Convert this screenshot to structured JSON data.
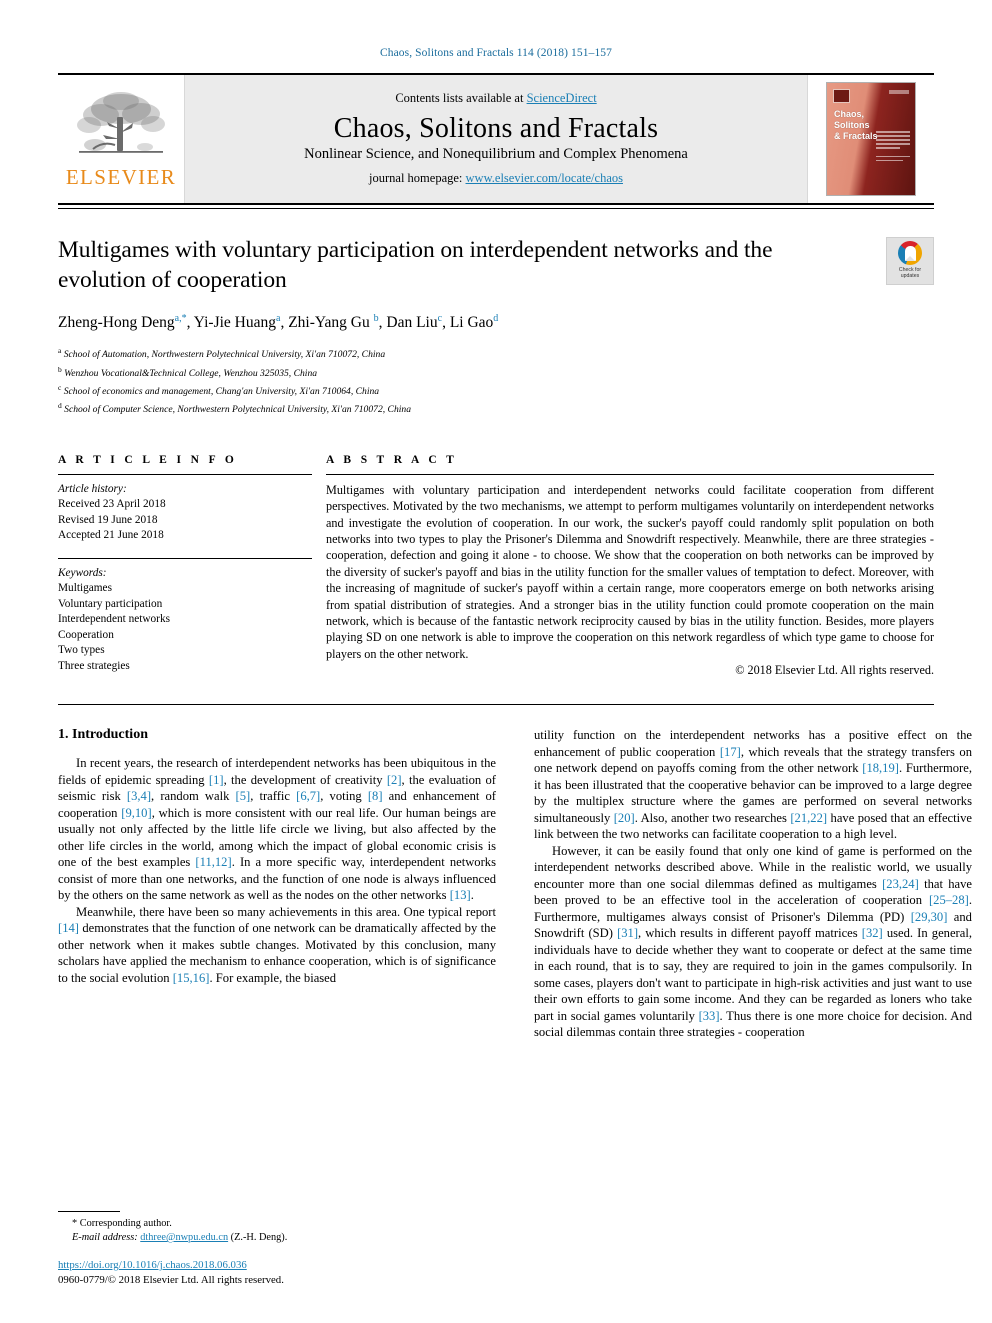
{
  "running_head": "Chaos, Solitons and Fractals 114 (2018) 151–157",
  "masthead": {
    "publisher_name": "ELSEVIER",
    "contents_prefix": "Contents lists available at ",
    "contents_link": "ScienceDirect",
    "journal_title": "Chaos, Solitons and Fractals",
    "journal_subtitle": "Nonlinear Science, and Nonequilibrium and Complex Phenomena",
    "homepage_prefix": "journal homepage: ",
    "homepage_link": "www.elsevier.com/locate/chaos",
    "cover_title": "Chaos, Solitons & Fractals"
  },
  "article": {
    "title": "Multigames with voluntary participation on interdependent networks and the evolution of cooperation",
    "crossmark_label": "Check for updates",
    "authors_html": "Zheng-Hong Deng<sup class=\"aff\">a</sup><sup class=\"star\">,*</sup>, Yi-Jie Huang<sup class=\"aff\">a</sup>, Zhi-Yang Gu <sup class=\"aff\">b</sup>, Dan Liu<sup class=\"aff\">c</sup>, Li Gao<sup class=\"aff\">d</sup>",
    "affiliations": [
      {
        "mark": "a",
        "text": "School of Automation, Northwestern Polytechnical University, Xi'an 710072, China"
      },
      {
        "mark": "b",
        "text": "Wenzhou Vocational&Technical College, Wenzhou 325035, China"
      },
      {
        "mark": "c",
        "text": "School of economics and management, Chang'an University, Xi'an 710064, China"
      },
      {
        "mark": "d",
        "text": "School of Computer Science, Northwestern Polytechnical University, Xi'an 710072, China"
      }
    ]
  },
  "article_info": {
    "heading": "A R T I C L E    I N F O",
    "history_label": "Article history:",
    "history": [
      "Received 23 April 2018",
      "Revised 19 June 2018",
      "Accepted 21 June 2018"
    ],
    "keywords_label": "Keywords:",
    "keywords": [
      "Multigames",
      "Voluntary participation",
      "Interdependent networks",
      "Cooperation",
      "Two types",
      "Three strategies"
    ]
  },
  "abstract": {
    "heading": "A B S T R A C T",
    "text": "Multigames with voluntary participation and interdependent networks could facilitate cooperation from different perspectives. Motivated by the two mechanisms, we attempt to perform multigames voluntarily on interdependent networks and investigate the evolution of cooperation. In our work, the sucker's payoff could randomly split population on both networks into two types to play the Prisoner's Dilemma and Snowdrift respectively. Meanwhile, there are three strategies - cooperation, defection and going it alone - to choose. We show that the cooperation on both networks can be improved by the diversity of sucker's payoff and bias in the utility function for the smaller values of temptation to defect. Moreover, with the increasing of magnitude of sucker's payoff within a certain range, more cooperators emerge on both networks arising from spatial distribution of strategies. And a stronger bias in the utility function could promote cooperation on the main network, which is because of the fantastic network reciprocity caused by bias in the utility function. Besides, more players playing SD on one network is able to improve the cooperation on this network regardless of which type game to choose for players on the other network.",
    "copyright": "© 2018 Elsevier Ltd. All rights reserved."
  },
  "introduction": {
    "heading": "1. Introduction",
    "left_paragraphs_html": [
      "In recent years, the research of interdependent networks has been ubiquitous in the fields of epidemic spreading <span class=\"ref\">[1]</span>, the development of creativity <span class=\"ref\">[2]</span>, the evaluation of seismic risk <span class=\"ref\">[3,4]</span>, random walk <span class=\"ref\">[5]</span>, traffic <span class=\"ref\">[6,7]</span>, voting <span class=\"ref\">[8]</span> and enhancement of cooperation <span class=\"ref\">[9,10]</span>, which is more consistent with our real life. Our human beings are usually not only affected by the little life circle we living, but also affected by the other life circles in the world, among which the impact of global economic crisis is one of the best examples <span class=\"ref\">[11,12]</span>. In a more specific way, interdependent networks consist of more than one networks, and the function of one node is always influenced by the others on the same network as well as the nodes on the other networks <span class=\"ref\">[13]</span>.",
      "Meanwhile, there have been so many achievements in this area. One typical report <span class=\"ref\">[14]</span> demonstrates that the function of one network can be dramatically affected by the other network when it makes subtle changes. Motivated by this conclusion, many scholars have applied the mechanism to enhance cooperation, which is of significance to the social evolution <span class=\"ref\">[15,16]</span>. For example, the biased"
    ],
    "right_paragraphs_html": [
      "utility function on the interdependent networks has a positive effect on the enhancement of public cooperation <span class=\"ref\">[17]</span>, which reveals that the strategy transfers on one network depend on payoffs coming from the other network <span class=\"ref\">[18,19]</span>. Furthermore, it has been illustrated that the cooperative behavior can be improved to a large degree by the multiplex structure where the games are performed on several networks simultaneously <span class=\"ref\">[20]</span>. Also, another two researches <span class=\"ref\">[21,22]</span> have posed that an effective link between the two networks can facilitate cooperation to a high level.",
      "However, it can be easily found that only one kind of game is performed on the interdependent networks described above. While in the realistic world, we usually encounter more than one social dilemmas defined as multigames <span class=\"ref\">[23,24]</span> that have been proved to be an effective tool in the acceleration of cooperation <span class=\"ref\">[25–28]</span>. Furthermore, multigames always consist of Prisoner's Dilemma (PD) <span class=\"ref\">[29,30]</span> and Snowdrift (SD) <span class=\"ref\">[31]</span>, which results in different payoff matrices <span class=\"ref\">[32]</span> used. In general, individuals have to decide whether they want to cooperate or defect at the same time in each round, that is to say, they are required to join in the games compulsorily. In some cases, players don't want to participate in high-risk activities and just want to use their own efforts to gain some income. And they can be regarded as loners who take part in social games voluntarily <span class=\"ref\">[33]</span>. Thus there is one more choice for decision. And social dilemmas contain three strategies - cooperation"
    ]
  },
  "footnote": {
    "corresponding_author": "Corresponding author.",
    "email_label": "E-mail address:",
    "email": "dthree@nwpu.edu.cn",
    "email_suffix": "(Z.-H. Deng).",
    "doi": "https://doi.org/10.1016/j.chaos.2018.06.036",
    "issn_line": "0960-0779/© 2018 Elsevier Ltd. All rights reserved."
  },
  "colors": {
    "link": "#1a7fb5",
    "running_head": "#1a6c9c",
    "elsevier_orange": "#E88A1A",
    "masthead_bg": "#ebebeb"
  }
}
